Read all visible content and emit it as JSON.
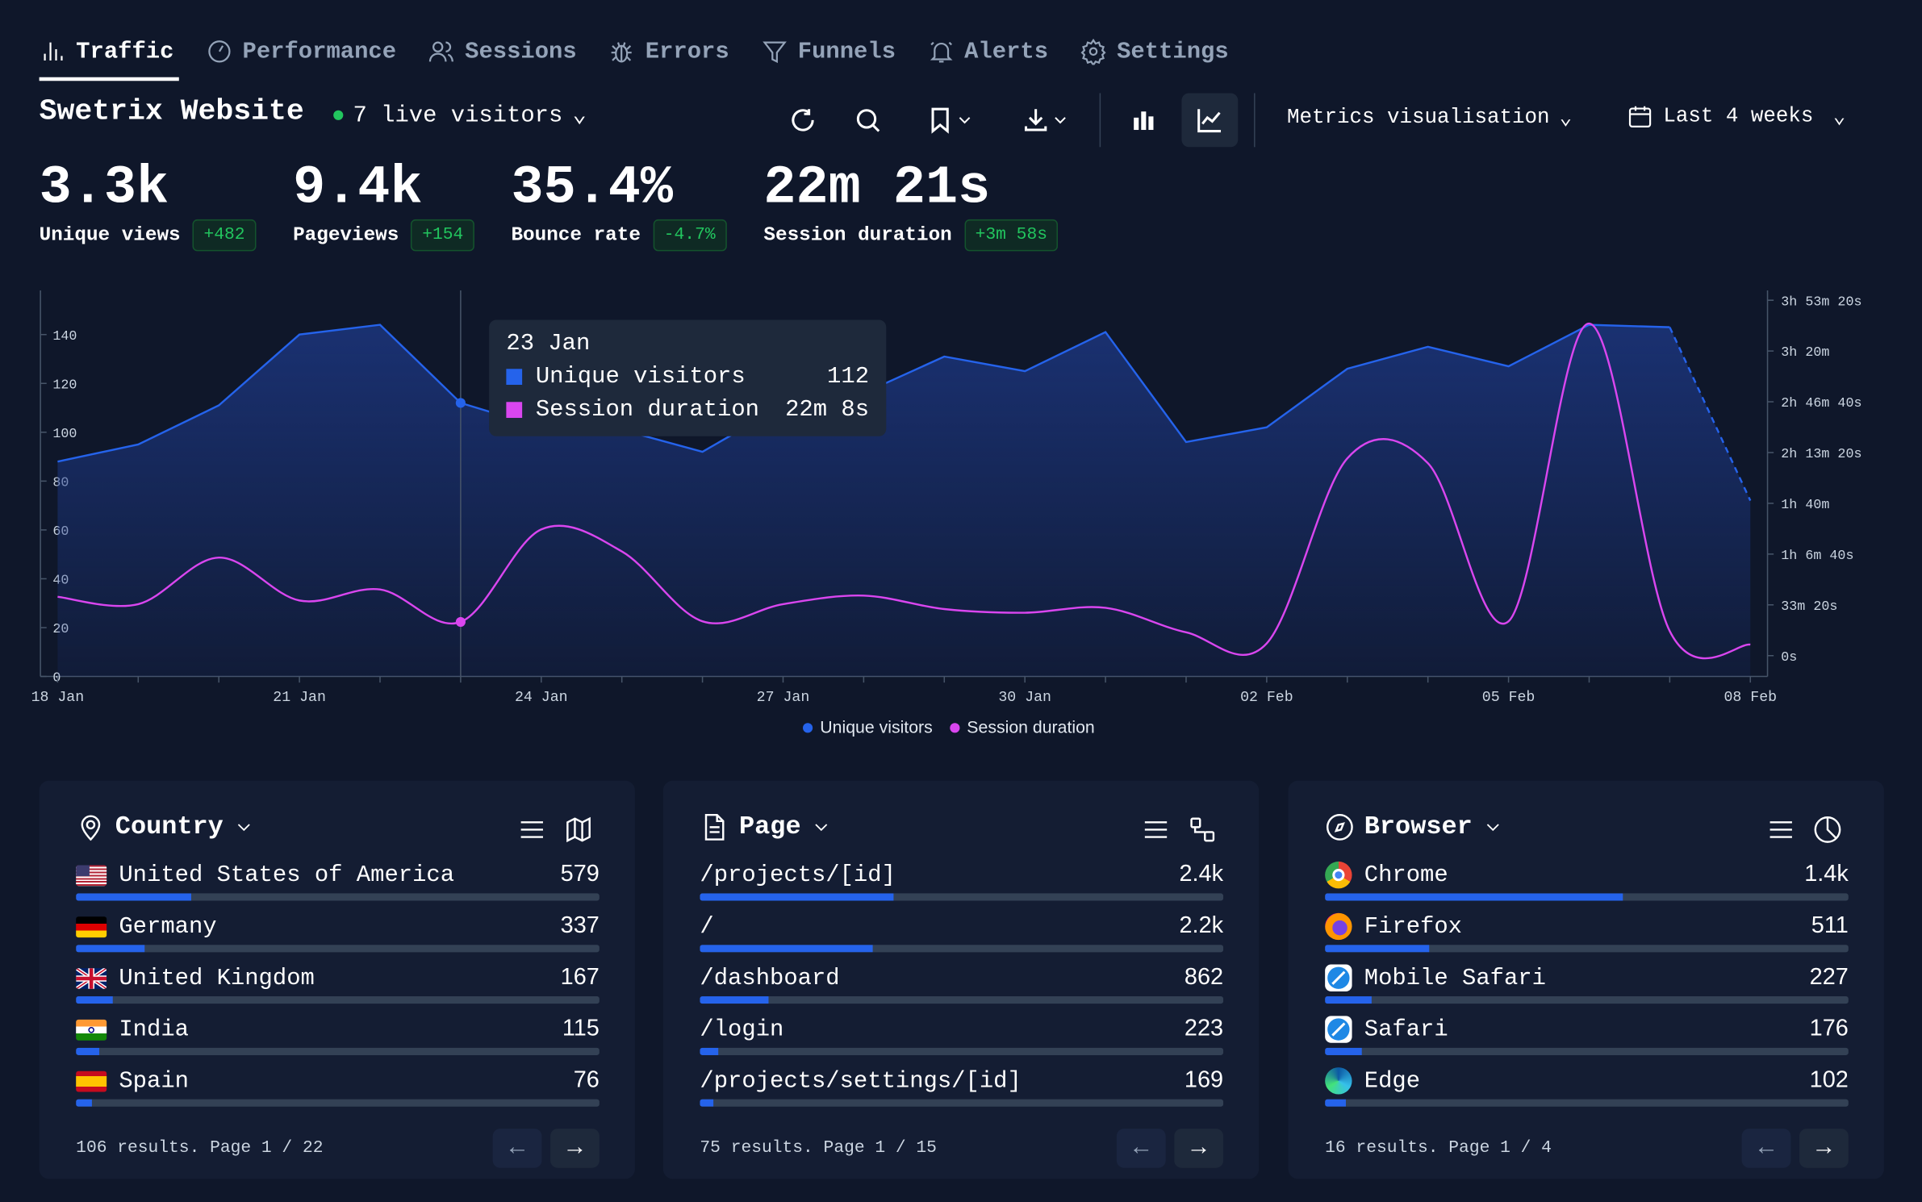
{
  "tabs": [
    {
      "label": "Traffic",
      "icon": "bar-chart-icon",
      "active": true
    },
    {
      "label": "Performance",
      "icon": "gauge-icon"
    },
    {
      "label": "Sessions",
      "icon": "users-icon"
    },
    {
      "label": "Errors",
      "icon": "bug-icon"
    },
    {
      "label": "Funnels",
      "icon": "funnel-icon"
    },
    {
      "label": "Alerts",
      "icon": "bell-icon"
    },
    {
      "label": "Settings",
      "icon": "gear-icon"
    }
  ],
  "header": {
    "title": "Swetrix Website",
    "live": "7 live visitors",
    "metrics_label": "Metrics visualisation",
    "period": "Last 4 weeks"
  },
  "metrics": [
    {
      "value": "3.3k",
      "label": "Unique views",
      "delta": "+482"
    },
    {
      "value": "9.4k",
      "label": "Pageviews",
      "delta": "+154"
    },
    {
      "value": "35.4%",
      "label": "Bounce rate",
      "delta": "-4.7%"
    },
    {
      "value": "22m 21s",
      "label": "Session duration",
      "delta": "+3m 58s"
    }
  ],
  "colors": {
    "accent": "#2563eb",
    "session": "#d946ef",
    "positive": "#22c55e",
    "bg": "#0f172a"
  },
  "chart_data": {
    "type": "line",
    "x": [
      "18 Jan",
      "19 Jan",
      "20 Jan",
      "21 Jan",
      "22 Jan",
      "23 Jan",
      "24 Jan",
      "25 Jan",
      "26 Jan",
      "27 Jan",
      "28 Jan",
      "29 Jan",
      "30 Jan",
      "31 Jan",
      "01 Feb",
      "02 Feb",
      "03 Feb",
      "04 Feb",
      "05 Feb",
      "06 Feb",
      "07 Feb",
      "08 Feb"
    ],
    "x_tick_labels": [
      "18 Jan",
      "21 Jan",
      "24 Jan",
      "27 Jan",
      "30 Jan",
      "02 Feb",
      "05 Feb",
      "08 Feb"
    ],
    "y_ticks": [
      "0",
      "20",
      "40",
      "60",
      "80",
      "100",
      "120",
      "140"
    ],
    "y2_ticks": [
      "0s",
      "33m 20s",
      "1h 6m 40s",
      "1h 40m",
      "2h 13m 20s",
      "2h 46m 40s",
      "3h 20m",
      "3h 53m 20s"
    ],
    "ylim": [
      0,
      150
    ],
    "y2lim_seconds": [
      0,
      14000
    ],
    "series": [
      {
        "name": "Unique visitors",
        "axis": "left",
        "type": "area",
        "values": [
          88,
          95,
          111,
          140,
          144,
          112,
          102,
          101,
          92,
          111,
          116,
          131,
          125,
          141,
          96,
          102,
          126,
          135,
          127,
          144,
          143,
          72
        ]
      },
      {
        "name": "Session duration",
        "axis": "right",
        "unit": "seconds",
        "type": "smooth-line",
        "values": [
          2317,
          2028,
          3862,
          2172,
          2607,
          1328,
          4972,
          4103,
          1352,
          2028,
          2365,
          1834,
          1690,
          1883,
          917,
          483,
          7772,
          7580,
          1352,
          13082,
          965,
          434
        ]
      }
    ],
    "legend": "bottom-center",
    "tooltip": {
      "date": "23 Jan",
      "rows": [
        {
          "label": "Unique visitors",
          "value": "112"
        },
        {
          "label": "Session duration",
          "value": "22m 8s"
        }
      ]
    }
  },
  "panels": [
    {
      "title": "Country",
      "icon": "map-pin-icon",
      "footer": "106 results. Page 1 / 22",
      "rows": [
        {
          "label": "United States of America",
          "count": "579",
          "flag": "us",
          "pct": 22
        },
        {
          "label": "Germany",
          "count": "337",
          "flag": "de",
          "pct": 13
        },
        {
          "label": "United Kingdom",
          "count": "167",
          "flag": "gb",
          "pct": 7
        },
        {
          "label": "India",
          "count": "115",
          "flag": "in",
          "pct": 4.5
        },
        {
          "label": "Spain",
          "count": "76",
          "flag": "es",
          "pct": 3
        }
      ]
    },
    {
      "title": "Page",
      "icon": "file-icon",
      "footer": "75 results. Page 1 / 15",
      "rows": [
        {
          "label": "/projects/[id]",
          "count": "2.4k",
          "pct": 37
        },
        {
          "label": "/",
          "count": "2.2k",
          "pct": 33
        },
        {
          "label": "/dashboard",
          "count": "862",
          "pct": 13
        },
        {
          "label": "/login",
          "count": "223",
          "pct": 3.5
        },
        {
          "label": "/projects/settings/[id]",
          "count": "169",
          "pct": 2.5
        }
      ]
    },
    {
      "title": "Browser",
      "icon": "compass-icon",
      "footer": "16 results. Page 1 / 4",
      "rows": [
        {
          "label": "Chrome",
          "count": "1.4k",
          "icon": "chrome",
          "pct": 57
        },
        {
          "label": "Firefox",
          "count": "511",
          "icon": "firefox",
          "pct": 20
        },
        {
          "label": "Mobile Safari",
          "count": "227",
          "icon": "safari",
          "pct": 9
        },
        {
          "label": "Safari",
          "count": "176",
          "icon": "safari",
          "pct": 7
        },
        {
          "label": "Edge",
          "count": "102",
          "icon": "edge",
          "pct": 4
        }
      ]
    }
  ]
}
